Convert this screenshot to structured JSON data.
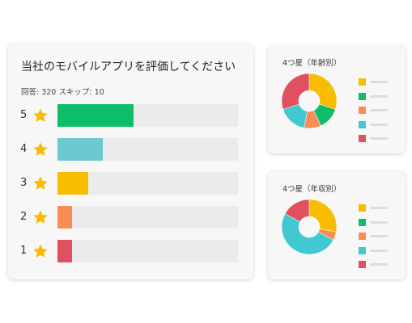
{
  "colors": {
    "yellow": "#f8bd00",
    "green": "#0ebd6a",
    "orange": "#fa8c54",
    "teal": "#40c9d1",
    "red": "#e1505f",
    "star": "#f8bd00"
  },
  "chart_data": [
    {
      "type": "bar",
      "orientation": "horizontal",
      "title": "当社のモバイルアプリを評価してください",
      "responses_label": "回答: 320",
      "skips_label": "スキップ: 10",
      "categories": [
        "5",
        "4",
        "3",
        "2",
        "1"
      ],
      "values": [
        42,
        25,
        17,
        8,
        8
      ],
      "value_unit": "%",
      "xlim": [
        0,
        100
      ],
      "bar_colors": [
        "#0ebd6a",
        "#6cc8d1",
        "#f8bd00",
        "#fa8c54",
        "#e1505f"
      ],
      "grid": false
    },
    {
      "type": "pie",
      "donut": true,
      "title": "4つ星（年齢別）",
      "values": [
        30,
        13,
        10,
        17,
        30
      ],
      "colors": [
        "#f8bd00",
        "#0ebd6a",
        "#fa8c54",
        "#40c9d1",
        "#e1505f"
      ],
      "legend_placement": "right"
    },
    {
      "type": "pie",
      "donut": true,
      "title": "4つ星（年収別）",
      "values": [
        28,
        0,
        5,
        50,
        17
      ],
      "colors": [
        "#f8bd00",
        "#0ebd6a",
        "#fa8c54",
        "#40c9d1",
        "#e1505f"
      ],
      "legend_placement": "right"
    }
  ]
}
